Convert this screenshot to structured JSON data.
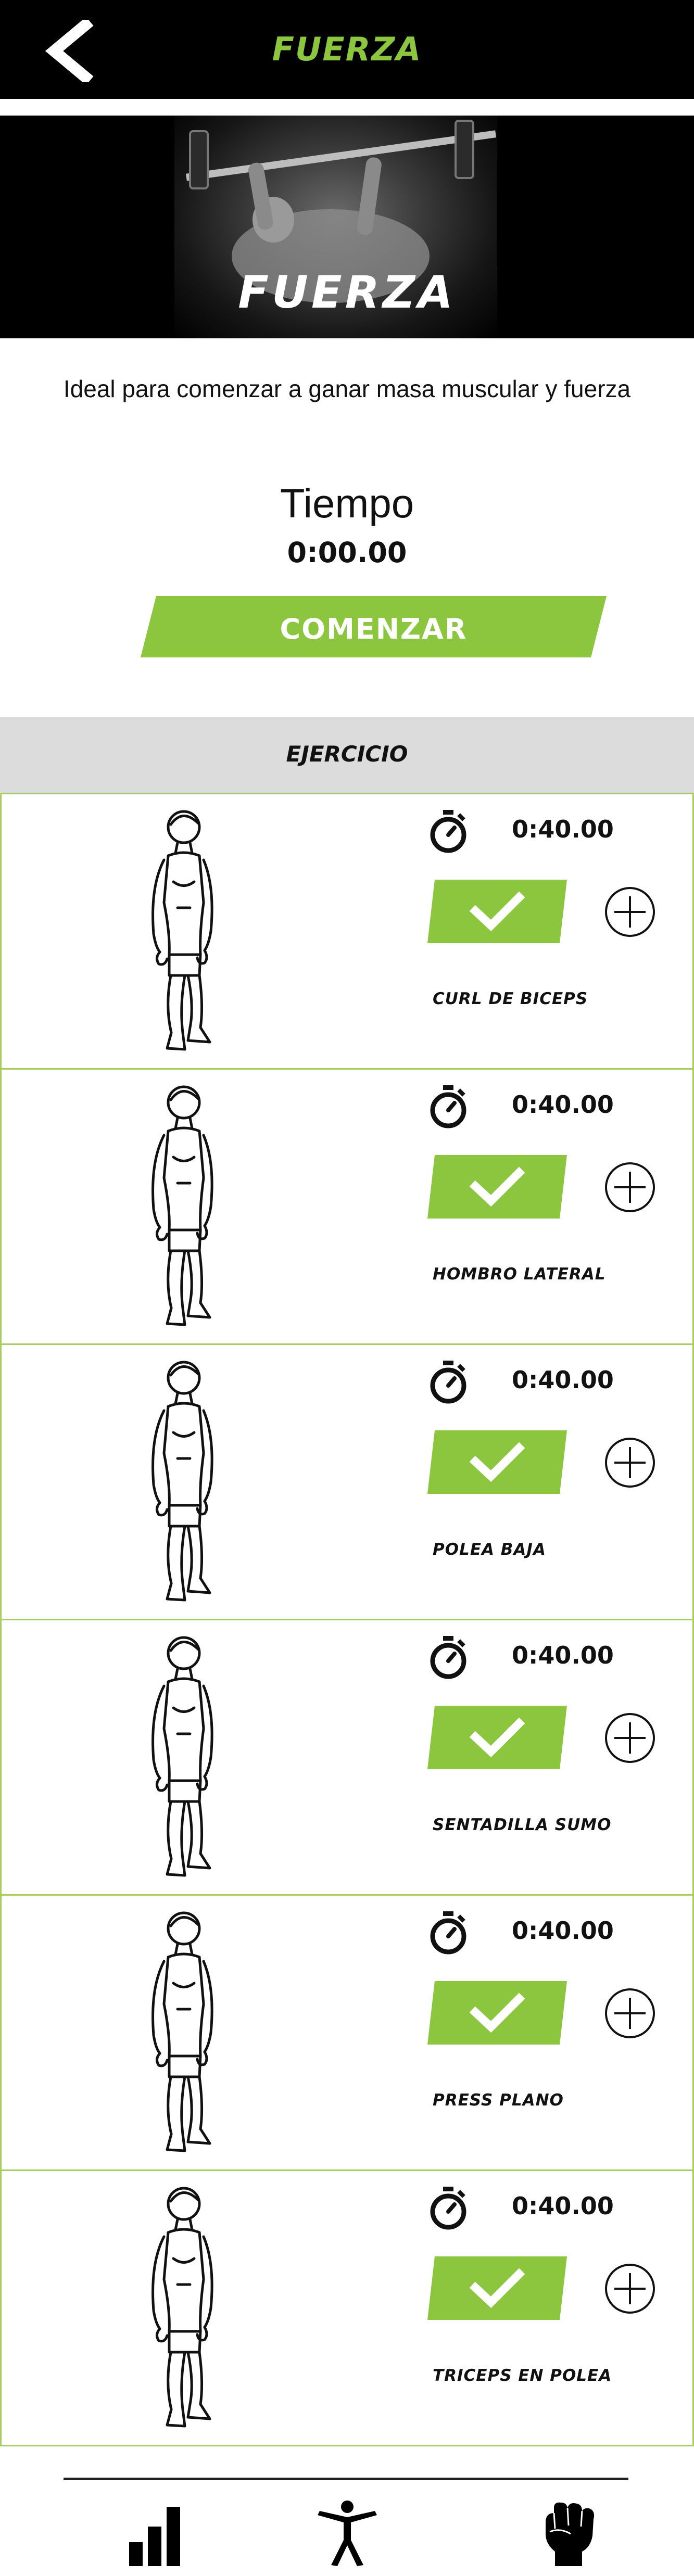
{
  "header": {
    "title": "FUERZA",
    "back_icon": "chevron-left-icon",
    "accent_color": "#8cc63f"
  },
  "hero": {
    "title": "FUERZA",
    "image": "bench-press-photo"
  },
  "subtitle": "Ideal para comenzar a ganar masa muscular y fuerza",
  "timer": {
    "label": "Tiempo",
    "value": "0:00.00"
  },
  "start_button": {
    "label": "COMENZAR",
    "color": "#8cc63f"
  },
  "section": {
    "title": "EJERCICIO",
    "background": "#dcdcdc"
  },
  "exercises": [
    {
      "name": "CURL DE BICEPS",
      "time": "0:40.00"
    },
    {
      "name": "HOMBRO LATERAL",
      "time": "0:40.00"
    },
    {
      "name": "POLEA BAJA",
      "time": "0:40.00"
    },
    {
      "name": "SENTADILLA SUMO",
      "time": "0:40.00"
    },
    {
      "name": "PRESS PLANO",
      "time": "0:40.00"
    },
    {
      "name": "TRICEPS EN POLEA",
      "time": "0:40.00"
    }
  ],
  "bottom_nav": {
    "items": [
      {
        "icon": "bar-chart-icon"
      },
      {
        "icon": "person-icon"
      },
      {
        "icon": "fist-icon"
      }
    ]
  }
}
